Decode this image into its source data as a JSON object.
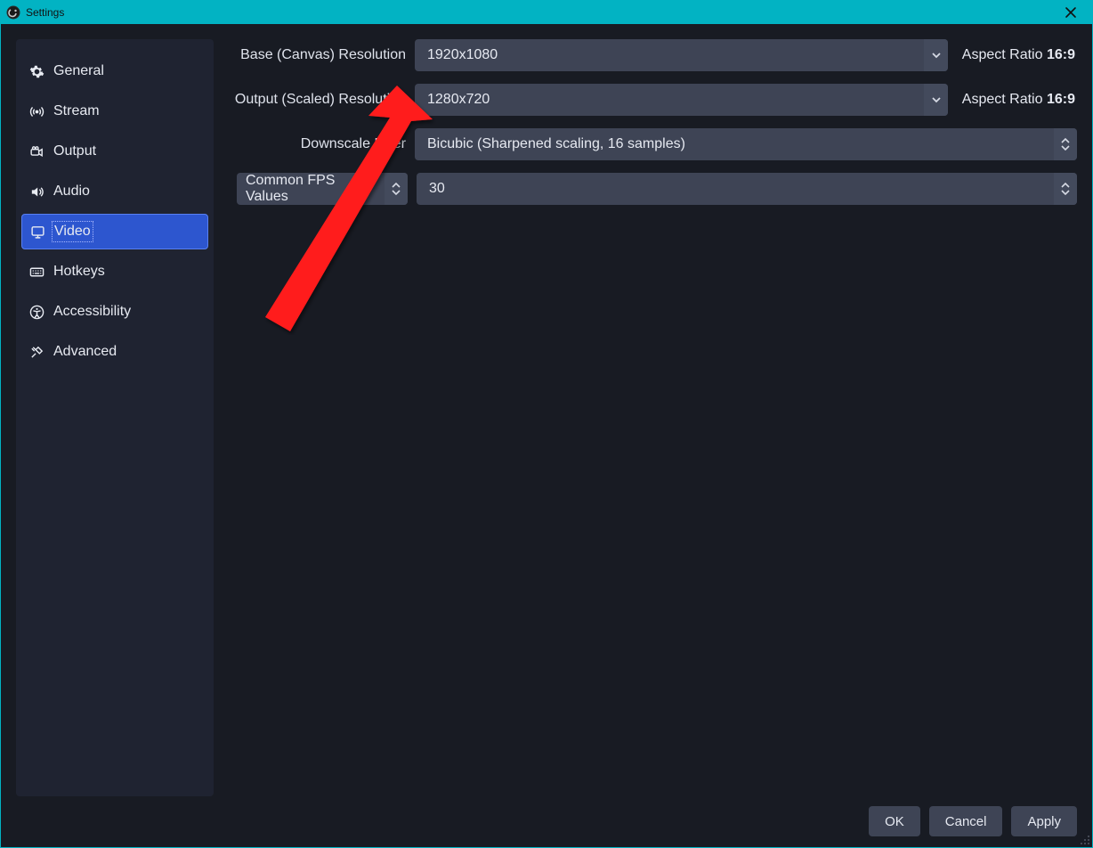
{
  "window": {
    "title": "Settings"
  },
  "sidebar": {
    "items": [
      {
        "id": "general",
        "label": "General"
      },
      {
        "id": "stream",
        "label": "Stream"
      },
      {
        "id": "output",
        "label": "Output"
      },
      {
        "id": "audio",
        "label": "Audio"
      },
      {
        "id": "video",
        "label": "Video"
      },
      {
        "id": "hotkeys",
        "label": "Hotkeys"
      },
      {
        "id": "accessibility",
        "label": "Accessibility"
      },
      {
        "id": "advanced",
        "label": "Advanced"
      }
    ],
    "active_id": "video"
  },
  "video": {
    "base_resolution": {
      "label": "Base (Canvas) Resolution",
      "value": "1920x1080",
      "aspect_label": "Aspect Ratio",
      "aspect_value": "16:9"
    },
    "output_resolution": {
      "label": "Output (Scaled) Resolution",
      "value": "1280x720",
      "aspect_label": "Aspect Ratio",
      "aspect_value": "16:9"
    },
    "downscale_filter": {
      "label": "Downscale Filter",
      "value": "Bicubic (Sharpened scaling, 16 samples)"
    },
    "fps": {
      "type_label": "Common FPS Values",
      "value": "30"
    }
  },
  "footer": {
    "ok": "OK",
    "cancel": "Cancel",
    "apply": "Apply"
  },
  "annotation": {
    "arrow_color": "#ff1d1d"
  }
}
